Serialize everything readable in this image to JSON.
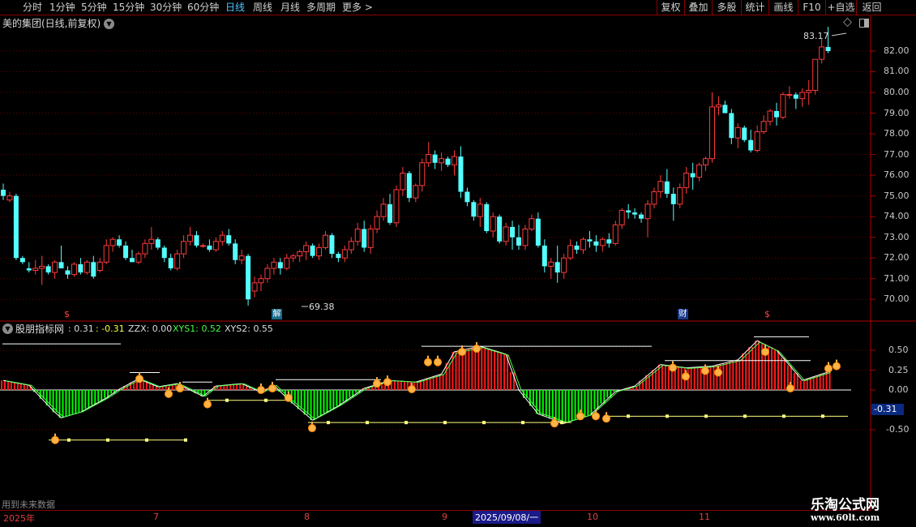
{
  "toolbar": {
    "periods": [
      "分时",
      "1分钟",
      "5分钟",
      "15分钟",
      "30分钟",
      "60分钟",
      "日线",
      "周线",
      "月线",
      "多周期",
      "更多 >"
    ],
    "active": "日线",
    "right": [
      "复权",
      "叠加",
      "多股",
      "统计",
      "画线",
      "F10",
      "+自选",
      "返回"
    ]
  },
  "stock": {
    "title": "美的集团(日线,前复权)"
  },
  "price_axis": {
    "ticks": [
      "82.00",
      "81.00",
      "80.00",
      "79.00",
      "78.00",
      "77.00",
      "76.00",
      "75.00",
      "74.00",
      "73.00",
      "72.00",
      "71.00",
      "70.00"
    ]
  },
  "annotations": {
    "high": "83.17",
    "low": "69.38"
  },
  "markers": {
    "jie": "解",
    "cai": "财",
    "s1": "$",
    "s2": "$"
  },
  "indicator": {
    "name": "股朋指标网",
    "v1": ": 0.31",
    "v2": ": -0.31",
    "zzx": "ZZX: 0.00",
    "xys1": "XYS1: 0.52",
    "xys2": "XYS2: 0.55",
    "ticks": [
      "0.50",
      "0.25",
      "0.00",
      "-0.50"
    ],
    "current": "-0.31"
  },
  "footer": {
    "note": "用到未来数据",
    "dates": [
      "2025年",
      "7",
      "8",
      "9",
      "2025/09/08/一",
      "10",
      "11"
    ]
  },
  "watermark": {
    "line1": "乐淘公式网",
    "line2": "www.60lt.com"
  },
  "colors": {
    "up": "#ff3b3b",
    "down": "#54ffff",
    "green_bar": "#00ff00",
    "red_bar": "#ff1a1a",
    "axis": "#b00000",
    "active": "#4fc3ff"
  },
  "chart_data": {
    "type": "candlestick",
    "ylim": [
      69.5,
      82.9
    ],
    "candles": [
      [
        75.3,
        75.6,
        74.8,
        75.0
      ],
      [
        74.8,
        75.2,
        74.7,
        75.0
      ],
      [
        75.0,
        75.1,
        71.9,
        72.0
      ],
      [
        72.0,
        72.1,
        71.7,
        71.8
      ],
      [
        71.5,
        71.8,
        71.3,
        71.4
      ],
      [
        71.4,
        71.9,
        71.2,
        71.5
      ],
      [
        71.5,
        72.1,
        70.7,
        71.6
      ],
      [
        71.6,
        71.7,
        71.2,
        71.3
      ],
      [
        71.3,
        71.9,
        71.0,
        71.8
      ],
      [
        71.8,
        72.6,
        71.6,
        71.5
      ],
      [
        71.4,
        71.6,
        71.0,
        71.2
      ],
      [
        71.2,
        71.8,
        71.1,
        71.7
      ],
      [
        71.7,
        72.0,
        71.2,
        71.3
      ],
      [
        71.3,
        71.9,
        71.2,
        71.8
      ],
      [
        71.8,
        72.1,
        71.0,
        71.1
      ],
      [
        71.4,
        72.0,
        71.3,
        71.8
      ],
      [
        71.8,
        72.9,
        71.7,
        72.6
      ],
      [
        72.6,
        73.0,
        72.3,
        72.9
      ],
      [
        72.9,
        73.1,
        72.5,
        72.6
      ],
      [
        72.6,
        72.8,
        71.9,
        72.0
      ],
      [
        72.0,
        72.4,
        71.8,
        71.8
      ],
      [
        71.8,
        72.3,
        71.7,
        72.2
      ],
      [
        72.2,
        72.9,
        72.0,
        72.7
      ],
      [
        72.7,
        73.5,
        72.4,
        72.9
      ],
      [
        72.9,
        73.0,
        72.4,
        72.5
      ],
      [
        72.5,
        72.6,
        71.8,
        72.0
      ],
      [
        72.0,
        72.2,
        71.4,
        71.5
      ],
      [
        71.5,
        72.4,
        71.4,
        72.2
      ],
      [
        72.2,
        73.1,
        72.0,
        72.8
      ],
      [
        72.8,
        73.5,
        72.6,
        73.1
      ],
      [
        73.1,
        73.3,
        72.5,
        72.6
      ],
      [
        72.6,
        72.7,
        72.5,
        72.6
      ],
      [
        72.6,
        72.9,
        72.3,
        72.4
      ],
      [
        72.4,
        73.0,
        72.3,
        72.8
      ],
      [
        72.8,
        73.3,
        72.6,
        73.1
      ],
      [
        73.1,
        73.4,
        72.6,
        72.7
      ],
      [
        72.7,
        72.9,
        71.7,
        71.9
      ],
      [
        71.9,
        72.4,
        71.7,
        72.1
      ],
      [
        72.1,
        72.2,
        69.7,
        70.0
      ],
      [
        70.4,
        71.1,
        70.1,
        70.8
      ],
      [
        70.8,
        71.2,
        70.4,
        71.0
      ],
      [
        71.0,
        71.7,
        70.8,
        71.5
      ],
      [
        71.5,
        72.0,
        71.2,
        71.8
      ],
      [
        71.8,
        72.0,
        71.2,
        71.5
      ],
      [
        71.5,
        72.2,
        71.4,
        72.0
      ],
      [
        72.0,
        72.2,
        71.8,
        72.1
      ],
      [
        72.1,
        72.4,
        71.8,
        72.3
      ],
      [
        72.3,
        72.8,
        71.9,
        72.6
      ],
      [
        72.6,
        72.7,
        72.0,
        72.1
      ],
      [
        72.1,
        72.7,
        71.9,
        72.5
      ],
      [
        72.5,
        73.3,
        72.4,
        73.1
      ],
      [
        73.1,
        73.2,
        72.0,
        72.2
      ],
      [
        72.2,
        72.3,
        71.8,
        72.0
      ],
      [
        72.0,
        72.6,
        71.8,
        72.4
      ],
      [
        72.4,
        73.0,
        72.2,
        72.8
      ],
      [
        72.8,
        73.7,
        72.6,
        73.4
      ],
      [
        73.4,
        73.8,
        72.3,
        72.5
      ],
      [
        72.5,
        73.6,
        72.2,
        73.4
      ],
      [
        73.4,
        74.3,
        73.2,
        74.0
      ],
      [
        74.0,
        74.9,
        73.8,
        74.6
      ],
      [
        74.6,
        75.1,
        73.6,
        73.7
      ],
      [
        73.7,
        75.5,
        73.5,
        75.3
      ],
      [
        75.3,
        76.4,
        75.0,
        76.1
      ],
      [
        76.1,
        76.2,
        74.7,
        74.9
      ],
      [
        74.9,
        75.6,
        74.7,
        75.5
      ],
      [
        75.5,
        76.8,
        75.2,
        76.6
      ],
      [
        76.6,
        77.6,
        76.4,
        77.0
      ],
      [
        77.0,
        77.2,
        76.3,
        76.6
      ],
      [
        76.6,
        77.1,
        76.2,
        76.8
      ],
      [
        76.8,
        76.9,
        76.4,
        76.5
      ],
      [
        76.5,
        77.2,
        76.0,
        76.9
      ],
      [
        76.9,
        77.4,
        74.9,
        75.2
      ],
      [
        75.2,
        75.4,
        74.5,
        74.7
      ],
      [
        74.7,
        74.8,
        73.8,
        74.0
      ],
      [
        74.0,
        74.9,
        73.5,
        74.6
      ],
      [
        74.6,
        74.7,
        73.2,
        73.3
      ],
      [
        73.3,
        74.2,
        73.0,
        74.0
      ],
      [
        74.0,
        74.1,
        72.7,
        72.8
      ],
      [
        72.8,
        73.7,
        72.6,
        73.5
      ],
      [
        73.5,
        73.8,
        72.4,
        73.0
      ],
      [
        73.0,
        73.6,
        72.4,
        72.6
      ],
      [
        72.6,
        73.6,
        72.4,
        73.4
      ],
      [
        73.4,
        74.1,
        73.3,
        73.9
      ],
      [
        73.9,
        74.2,
        72.5,
        72.6
      ],
      [
        72.6,
        72.9,
        71.3,
        71.6
      ],
      [
        71.6,
        72.0,
        71.0,
        71.8
      ],
      [
        71.8,
        72.6,
        70.8,
        71.3
      ],
      [
        71.3,
        72.2,
        71.0,
        72.0
      ],
      [
        72.0,
        72.9,
        71.9,
        72.6
      ],
      [
        72.6,
        72.8,
        72.2,
        72.4
      ],
      [
        72.4,
        73.0,
        72.2,
        72.9
      ],
      [
        72.9,
        73.3,
        72.5,
        72.8
      ],
      [
        72.8,
        73.1,
        72.3,
        72.6
      ],
      [
        72.6,
        73.0,
        72.3,
        72.9
      ],
      [
        72.9,
        73.2,
        72.5,
        72.7
      ],
      [
        72.7,
        73.8,
        72.6,
        73.6
      ],
      [
        73.6,
        74.4,
        73.4,
        74.3
      ],
      [
        74.3,
        74.6,
        73.9,
        74.2
      ],
      [
        74.2,
        74.4,
        73.9,
        74.1
      ],
      [
        74.1,
        74.2,
        73.7,
        73.9
      ],
      [
        73.9,
        74.8,
        73.0,
        74.6
      ],
      [
        74.6,
        75.4,
        74.4,
        75.2
      ],
      [
        75.2,
        76.0,
        74.9,
        75.7
      ],
      [
        75.7,
        76.3,
        74.9,
        75.1
      ],
      [
        75.1,
        75.4,
        73.8,
        74.6
      ],
      [
        74.6,
        75.6,
        74.4,
        75.4
      ],
      [
        75.4,
        76.4,
        75.1,
        76.1
      ],
      [
        76.1,
        76.6,
        75.3,
        75.9
      ],
      [
        75.9,
        76.6,
        75.7,
        76.5
      ],
      [
        76.5,
        76.9,
        76.2,
        76.8
      ],
      [
        76.8,
        80.0,
        76.6,
        79.3
      ],
      [
        79.3,
        79.8,
        78.9,
        79.4
      ],
      [
        79.4,
        79.6,
        79.0,
        79.0
      ],
      [
        79.0,
        79.2,
        77.5,
        77.8
      ],
      [
        77.8,
        78.5,
        77.3,
        78.3
      ],
      [
        78.3,
        78.4,
        77.6,
        77.7
      ],
      [
        77.7,
        78.2,
        77.1,
        77.2
      ],
      [
        77.2,
        78.4,
        77.1,
        78.1
      ],
      [
        78.1,
        78.9,
        78.0,
        78.6
      ],
      [
        78.6,
        79.2,
        78.4,
        79.1
      ],
      [
        79.1,
        79.5,
        78.4,
        78.8
      ],
      [
        78.8,
        80.0,
        78.7,
        79.9
      ],
      [
        79.9,
        80.3,
        79.7,
        79.9
      ],
      [
        79.9,
        80.0,
        79.2,
        79.7
      ],
      [
        79.7,
        80.2,
        79.3,
        80.0
      ],
      [
        80.0,
        80.6,
        79.4,
        80.1
      ],
      [
        80.1,
        81.4,
        79.9,
        81.6
      ],
      [
        81.6,
        82.6,
        81.4,
        82.2
      ],
      [
        82.2,
        83.17,
        81.9,
        82.0
      ]
    ]
  }
}
